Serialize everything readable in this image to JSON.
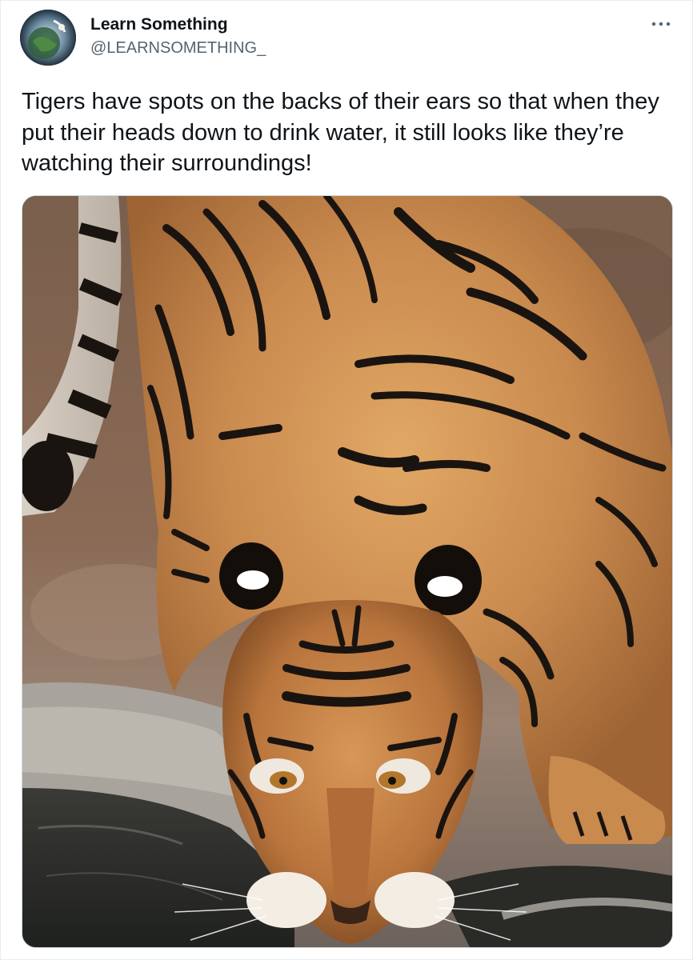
{
  "tweet": {
    "author": {
      "display_name": "Learn Something",
      "handle": "@LEARNSOMETHING_",
      "avatar_icon": "earth-avatar-icon"
    },
    "more_icon": "more-horizontal-icon",
    "text": "Tigers have spots on the backs of their ears so that when they put their heads down to drink water, it still looks like they’re watching their surroundings!",
    "media": {
      "type": "photo",
      "subject_icon": "tiger-drinking-photo"
    }
  },
  "colors": {
    "text_primary": "#0f1419",
    "text_secondary": "#536471",
    "border": "#e6ecf0",
    "tiger_orange": "#c98a4e",
    "stripe": "#1a1410"
  }
}
